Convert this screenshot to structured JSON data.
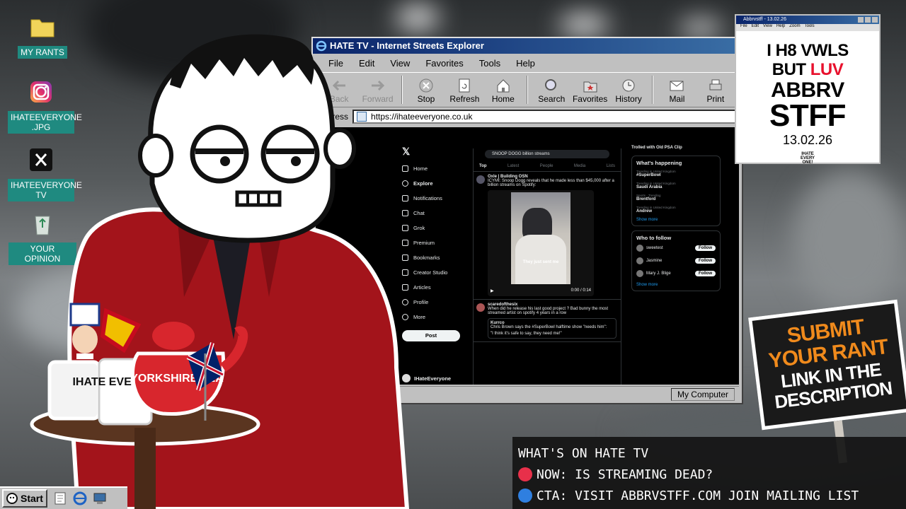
{
  "desktop": {
    "icons": [
      {
        "label": "MY RANTS",
        "icon": "folder-icon"
      },
      {
        "label": "IHATEEVERYONE .JPG",
        "icon": "instagram-icon"
      },
      {
        "label": "IHATEEVERYONE TV",
        "icon": "x-logo-icon"
      },
      {
        "label": "YOUR OPINION",
        "icon": "recycle-bin-icon"
      }
    ]
  },
  "browser": {
    "title": "HATE TV - Internet Streets Explorer",
    "menu": [
      "File",
      "Edit",
      "View",
      "Favorites",
      "Tools",
      "Help"
    ],
    "toolbar": [
      "Back",
      "Forward",
      "Stop",
      "Refresh",
      "Home",
      "Search",
      "Favorites",
      "History",
      "Mail",
      "Print"
    ],
    "address_label": "Address",
    "url": "https://ihateeveryone.co.uk",
    "status_zone": "My Computer",
    "page": {
      "nav": [
        "Home",
        "Explore",
        "Notifications",
        "Chat",
        "Grok",
        "Premium",
        "Bookmarks",
        "Creator Studio",
        "Articles",
        "Profile",
        "More"
      ],
      "post_button": "Post",
      "account_name": "IHateEveryone",
      "search_query": "SNOOP DOGG billion streams",
      "tabs": [
        "Top",
        "Latest",
        "People",
        "Media",
        "Lists"
      ],
      "tweet1_author": "Oxle | Building OSN",
      "tweet1_text": "ICYMI: Snoop Dogg reveals that he made less than $45,000 after a billion streams on Spotify:",
      "video_caption": "They just sent me",
      "video_time": "0:00 / 0:14",
      "tweet2_author": "scaredofthesix",
      "tweet2_text": "When did he release his last good project ? Bad bunny the most streamed artist on spotify 4 years in a row",
      "quote_author": "Kurrco",
      "quote_text": "Chris Brown says the #SuperBowl halftime show \"needs him\":",
      "quote_sub": "\"I think it's safe to say, they need me!\"",
      "side_top": "Trolled with Old PSA Clip",
      "whats_happening": "What's happening",
      "trends": [
        {
          "context": "Trending in United Kingdom",
          "topic": "#SuperBowl"
        },
        {
          "context": "Trending in United Kingdom",
          "topic": "Saudi Arabia"
        },
        {
          "context": "Sports · Trending",
          "topic": "Brentford"
        },
        {
          "context": "Trending in United Kingdom",
          "topic": "Andrew"
        }
      ],
      "show_more": "Show more",
      "who_to_follow": "Who to follow",
      "follow_suggestions": [
        "sweetest",
        "Jasmine",
        "Mary J. Blige"
      ],
      "follow_label": "Follow"
    }
  },
  "abbrv_window": {
    "title": "Abbrvstff - 13.02.26",
    "menu": [
      "File",
      "Edit",
      "View",
      "Help",
      "Zoom",
      "Tools"
    ],
    "line1": "I H8 VWLS",
    "line2a": "BUT ",
    "line2b": "LUV",
    "line3": "ABBRV",
    "line4": "STFF",
    "date": "13.02.26",
    "logo": "IHATE EVERY ONE!",
    "accent": "#e8112d"
  },
  "sign": {
    "line1": "SUBMIT",
    "line2": "YOUR RANT",
    "line3": "LINK IN THE",
    "line4": "DESCRIPTION",
    "color": "#f08a1c"
  },
  "info_panel": {
    "heading": "WHAT'S ON HATE TV",
    "now": "NOW: IS STREAMING DEAD?",
    "cta": "CTA: VISIT ABBRVSTFF.COM JOIN MAILING LIST",
    "now_color": "#e8304a",
    "cta_color": "#2f7fe0"
  },
  "props": {
    "mug1_text": "IHATE EVERY ONE!",
    "teapot_text": "YORKSHIRE TEA"
  },
  "taskbar": {
    "start_label": "Start"
  }
}
